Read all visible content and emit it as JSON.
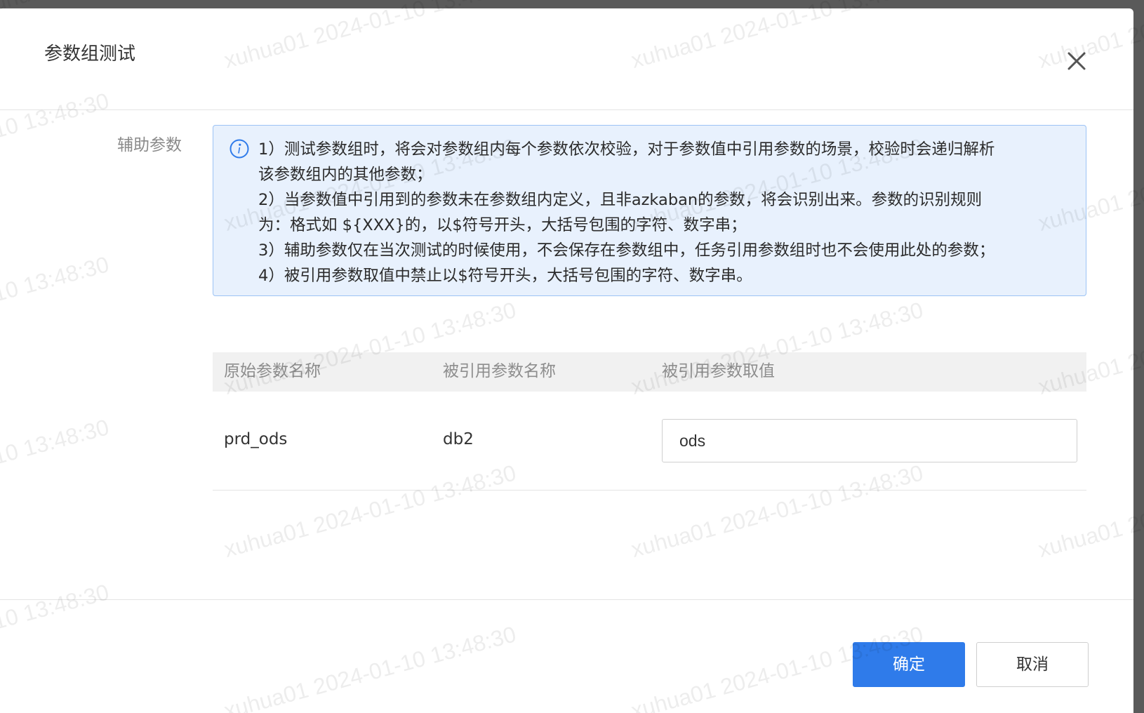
{
  "dialog": {
    "title": "参数组测试",
    "close_icon": "close-icon"
  },
  "form": {
    "aux_label": "辅助参数",
    "info_icon": "info-circle-icon",
    "info_lines": [
      "1）测试参数组时，将会对参数组内每个参数依次校验，对于参数值中引用参数的场景，校验时会递归解析",
      "该参数组内的其他参数；",
      "2）当参数值中引用到的参数未在参数组内定义，且非azkaban的参数，将会识别出来。参数的识别规则",
      "为：格式如 ${XXX}的，以$符号开头，大括号包围的字符、数字串；",
      "3）辅助参数仅在当次测试的时候使用，不会保存在参数组中，任务引用参数组时也不会使用此处的参数；",
      "4）被引用参数取值中禁止以$符号开头，大括号包围的字符、数字串。"
    ]
  },
  "table": {
    "headers": [
      "原始参数名称",
      "被引用参数名称",
      "被引用参数取值"
    ],
    "rows": [
      {
        "original": "prd_ods",
        "referenced": "db2",
        "value": "ods"
      }
    ]
  },
  "footer": {
    "confirm_label": "确定",
    "cancel_label": "取消"
  },
  "watermark": {
    "text": "xuhua01 2024-01-10 13:48:30"
  },
  "colors": {
    "primary": "#2f7bea",
    "info_bg": "#e8f1fd",
    "info_border": "#9cc3f5",
    "overlay": "#5a5a5a"
  }
}
